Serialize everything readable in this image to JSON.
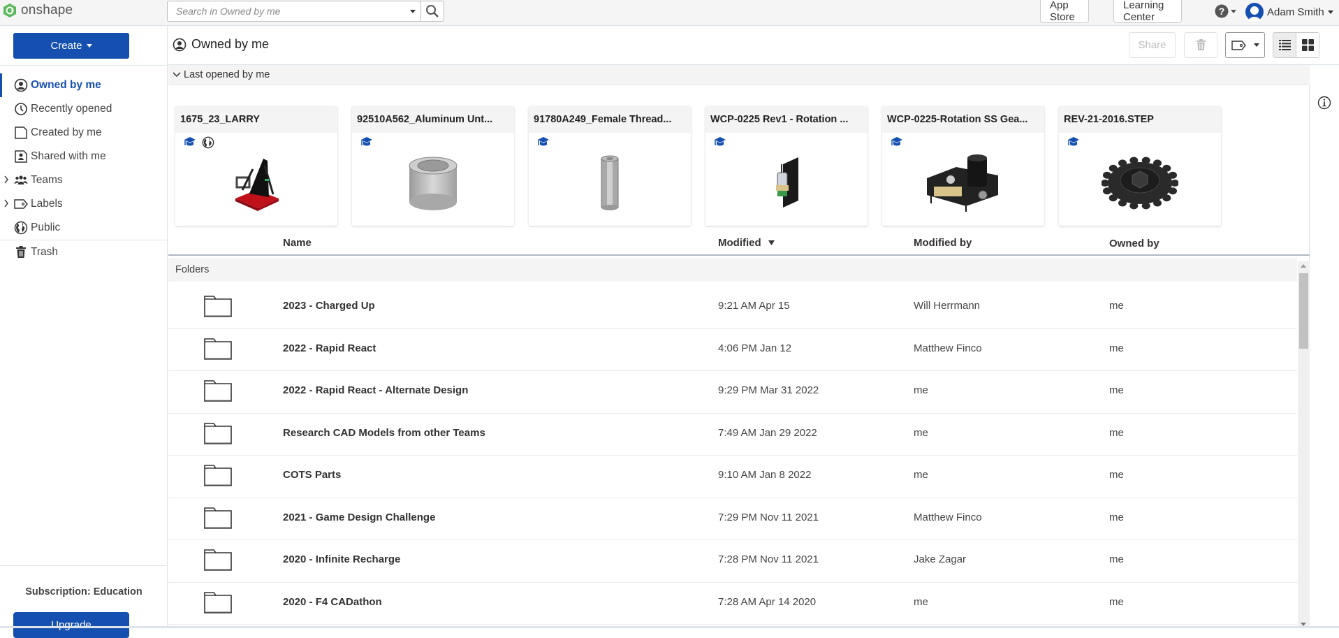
{
  "app": {
    "name": "onshape",
    "brand_color": "#1550b0",
    "logo_color": "#4caf50"
  },
  "topbar": {
    "search_placeholder": "Search in Owned by me",
    "app_store": "App Store",
    "learning_center": "Learning Center",
    "user_name": "Adam Smith"
  },
  "sidebar": {
    "create_label": "Create",
    "items": [
      {
        "label": "Owned by me",
        "icon": "person-circle-icon",
        "active": true
      },
      {
        "label": "Recently opened",
        "icon": "clock-icon"
      },
      {
        "label": "Created by me",
        "icon": "document-icon"
      },
      {
        "label": "Shared with me",
        "icon": "shared-document-icon"
      },
      {
        "label": "Teams",
        "icon": "teams-icon",
        "expandable": true
      },
      {
        "label": "Labels",
        "icon": "label-tag-icon",
        "expandable": true
      },
      {
        "label": "Public",
        "icon": "globe-icon"
      },
      {
        "label": "Trash",
        "icon": "trash-icon"
      }
    ],
    "subscription": "Subscription: Education",
    "upgrade_label": "Upgrade"
  },
  "header": {
    "title": "Owned by me",
    "share_label": "Share"
  },
  "recent": {
    "section_label": "Last opened by me",
    "cards": [
      {
        "title": "1675_23_LARRY",
        "badges": [
          "education",
          "public"
        ],
        "thumb": "robot"
      },
      {
        "title": "92510A562_Aluminum Unt...",
        "badges": [
          "education"
        ],
        "thumb": "spacer"
      },
      {
        "title": "91780A249_Female Thread...",
        "badges": [
          "education"
        ],
        "thumb": "standoff"
      },
      {
        "title": "WCP-0225 Rev1 - Rotation ...",
        "badges": [
          "education"
        ],
        "thumb": "gearbox-flat"
      },
      {
        "title": "WCP-0225-Rotation SS Gea...",
        "badges": [
          "education"
        ],
        "thumb": "gearbox"
      },
      {
        "title": "REV-21-2016.STEP",
        "badges": [
          "education"
        ],
        "thumb": "sprocket"
      }
    ]
  },
  "table": {
    "columns": {
      "name": "Name",
      "modified": "Modified",
      "modified_by": "Modified by",
      "owned_by": "Owned by"
    },
    "sort": {
      "column": "modified",
      "direction": "desc"
    },
    "group_label": "Folders",
    "rows": [
      {
        "name": "2023 - Charged Up",
        "modified": "9:21 AM Apr 15",
        "modified_by": "Will Herrmann",
        "owned_by": "me"
      },
      {
        "name": "2022 - Rapid React",
        "modified": "4:06 PM Jan 12",
        "modified_by": "Matthew Finco",
        "owned_by": "me"
      },
      {
        "name": "2022 - Rapid React - Alternate Design",
        "modified": "9:29 PM Mar 31 2022",
        "modified_by": "me",
        "owned_by": "me"
      },
      {
        "name": "Research CAD Models from other Teams",
        "modified": "7:49 AM Jan 29 2022",
        "modified_by": "me",
        "owned_by": "me"
      },
      {
        "name": "COTS Parts",
        "modified": "9:10 AM Jan 8 2022",
        "modified_by": "me",
        "owned_by": "me"
      },
      {
        "name": "2021 - Game Design Challenge",
        "modified": "7:29 PM Nov 11 2021",
        "modified_by": "Matthew Finco",
        "owned_by": "me"
      },
      {
        "name": "2020 - Infinite Recharge",
        "modified": "7:28 PM Nov 11 2021",
        "modified_by": "Jake Zagar",
        "owned_by": "me"
      },
      {
        "name": "2020 - F4 CADathon",
        "modified": "7:28 AM Apr 14 2020",
        "modified_by": "me",
        "owned_by": "me"
      }
    ]
  }
}
